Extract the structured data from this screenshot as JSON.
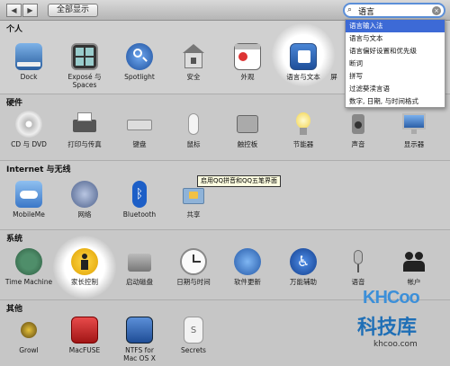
{
  "toolbar": {
    "back_label": "◀",
    "forward_label": "▶",
    "show_all_label": "全部显示",
    "search_value": "语言",
    "search_clear": "×"
  },
  "search_results": [
    "语言输入法",
    "语言与文本",
    "语言偏好设置和优先级",
    "断词",
    "拼写",
    "过滤葵渎言语",
    "数字, 日期, 与时间格式"
  ],
  "tooltip": "启用QQ拼音和QQ五笔界面",
  "sections": {
    "personal": {
      "title": "个人",
      "items": [
        "Dock",
        "Exposé 与\nSpaces",
        "Spotlight",
        "安全",
        "外观",
        "语言与文本",
        "屏"
      ]
    },
    "hardware": {
      "title": "硬件",
      "items": [
        "CD 与 DVD",
        "打印与传真",
        "键盘",
        "鼠标",
        "触控板",
        "节能器",
        "声音",
        "显示器"
      ]
    },
    "internet": {
      "title": "Internet 与无线",
      "items": [
        "MobileMe",
        "网络",
        "Bluetooth",
        "共享"
      ]
    },
    "system": {
      "title": "系统",
      "items": [
        "Time Machine",
        "家长控制",
        "启动磁盘",
        "日期与时间",
        "软件更新",
        "万能辅助",
        "语音",
        "帐户"
      ]
    },
    "other": {
      "title": "其他",
      "items": [
        "Growl",
        "MacFUSE",
        "NTFS for\nMac OS X",
        "Secrets"
      ]
    }
  },
  "watermark": {
    "logo": "KHCoo",
    "cn": "科技库",
    "url": "khcoo.com"
  }
}
